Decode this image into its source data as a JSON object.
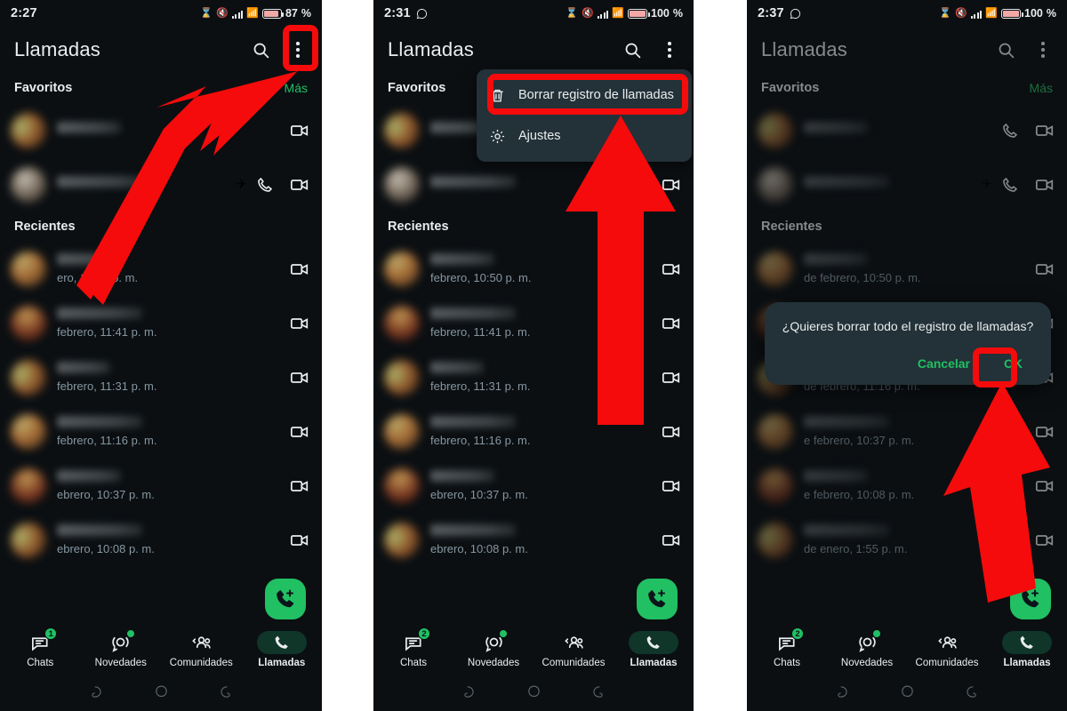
{
  "panels": [
    {
      "id": "panel-1",
      "status": {
        "time": "2:27",
        "battery": "87",
        "battery_suffix": "%",
        "wa_icon": false
      },
      "appbar": {
        "title": "Llamadas",
        "search_icon": "search-icon",
        "menu_icon": "overflow-menu-icon"
      },
      "favorites": {
        "label": "Favoritos",
        "more": "Más"
      },
      "recents": {
        "label": "Recientes"
      },
      "fav_rows": [
        {
          "subtitle": "",
          "has_phone": false,
          "has_video": true,
          "plane": ""
        },
        {
          "subtitle": "",
          "has_phone": true,
          "has_video": true,
          "plane": "✈"
        }
      ],
      "call_rows": [
        {
          "subtitle": "ero, 10:50 p. m.",
          "has_video": true
        },
        {
          "subtitle": "febrero, 11:41 p. m.",
          "has_video": true
        },
        {
          "subtitle": "febrero, 11:31 p. m.",
          "has_video": true
        },
        {
          "subtitle": "febrero, 11:16 p. m.",
          "has_video": true
        },
        {
          "subtitle": "ebrero, 10:37 p. m.",
          "has_video": true
        },
        {
          "subtitle": "ebrero, 10:08 p. m.",
          "has_video": true
        }
      ],
      "fab": {
        "icon": "add-call-icon"
      },
      "nav": [
        {
          "label": "Chats",
          "icon": "chats-icon",
          "badge": "1",
          "active": false
        },
        {
          "label": "Novedades",
          "icon": "status-updates-icon",
          "badge": "",
          "dot": true,
          "active": false
        },
        {
          "label": "Comunidades",
          "icon": "communities-icon",
          "badge": "",
          "active": false
        },
        {
          "label": "Llamadas",
          "icon": "calls-icon",
          "badge": "",
          "active": true
        }
      ],
      "menu": null,
      "dialog": null
    },
    {
      "id": "panel-2",
      "status": {
        "time": "2:31",
        "battery": "100",
        "battery_suffix": "%",
        "wa_icon": true
      },
      "appbar": {
        "title": "Llamadas",
        "search_icon": "search-icon",
        "menu_icon": "overflow-menu-icon"
      },
      "favorites": {
        "label": "Favoritos",
        "more": "Más"
      },
      "recents": {
        "label": "Recientes"
      },
      "fav_rows": [
        {
          "subtitle": "",
          "has_phone": false,
          "has_video": false,
          "plane": ""
        },
        {
          "subtitle": "",
          "has_phone": false,
          "has_video": true,
          "plane": "✈"
        }
      ],
      "call_rows": [
        {
          "subtitle": "febrero, 10:50 p. m.",
          "has_video": true
        },
        {
          "subtitle": "febrero, 11:41 p. m.",
          "has_video": true
        },
        {
          "subtitle": "febrero, 11:31 p. m.",
          "has_video": true
        },
        {
          "subtitle": "febrero, 11:16 p. m.",
          "has_video": true
        },
        {
          "subtitle": "ebrero, 10:37 p. m.",
          "has_video": true
        },
        {
          "subtitle": "ebrero, 10:08 p. m.",
          "has_video": true
        }
      ],
      "fab": {
        "icon": "add-call-icon"
      },
      "nav": [
        {
          "label": "Chats",
          "icon": "chats-icon",
          "badge": "2",
          "active": false
        },
        {
          "label": "Novedades",
          "icon": "status-updates-icon",
          "badge": "",
          "dot": true,
          "active": false
        },
        {
          "label": "Comunidades",
          "icon": "communities-icon",
          "badge": "",
          "active": false
        },
        {
          "label": "Llamadas",
          "icon": "calls-icon",
          "badge": "",
          "active": true
        }
      ],
      "menu": {
        "items": [
          {
            "label": "Borrar registro de llamadas",
            "icon": "trash-icon"
          },
          {
            "label": "Ajustes",
            "icon": "gear-icon"
          }
        ]
      },
      "dialog": null
    },
    {
      "id": "panel-3",
      "status": {
        "time": "2:37",
        "battery": "100",
        "battery_suffix": "%",
        "wa_icon": true
      },
      "appbar": {
        "title": "Llamadas",
        "search_icon": "search-icon",
        "menu_icon": "overflow-menu-icon"
      },
      "favorites": {
        "label": "Favoritos",
        "more": "Más"
      },
      "recents": {
        "label": "Recientes"
      },
      "fav_rows": [
        {
          "subtitle": "",
          "has_phone": true,
          "has_video": true,
          "plane": ""
        },
        {
          "subtitle": "",
          "has_phone": true,
          "has_video": true,
          "plane": "✈"
        }
      ],
      "call_rows": [
        {
          "subtitle": "de febrero, 10:50 p. m.",
          "has_video": true
        },
        {
          "subtitle": "",
          "has_video": true
        },
        {
          "subtitle": "de febrero, 11:16 p. m.",
          "has_video": true
        },
        {
          "subtitle": "e febrero, 10:37 p. m.",
          "has_video": true
        },
        {
          "subtitle": "e febrero, 10:08 p. m.",
          "has_video": true
        },
        {
          "subtitle": "de enero, 1:55 p. m.",
          "has_video": true
        }
      ],
      "fab": {
        "icon": "add-call-icon"
      },
      "nav": [
        {
          "label": "Chats",
          "icon": "chats-icon",
          "badge": "2",
          "active": false
        },
        {
          "label": "Novedades",
          "icon": "status-updates-icon",
          "badge": "",
          "dot": true,
          "active": false
        },
        {
          "label": "Comunidades",
          "icon": "communities-icon",
          "badge": "",
          "active": false
        },
        {
          "label": "Llamadas",
          "icon": "calls-icon",
          "badge": "",
          "active": true
        }
      ],
      "menu": null,
      "dialog": {
        "message": "¿Quieres borrar todo el registro de llamadas?",
        "cancel": "Cancelar",
        "ok": "OK"
      }
    }
  ],
  "colors": {
    "accent_green": "#21c063",
    "annotation_red": "#f50b0b",
    "surface": "#0b0f12",
    "menu_surface": "#233138",
    "secondary_text": "#8696a0"
  }
}
